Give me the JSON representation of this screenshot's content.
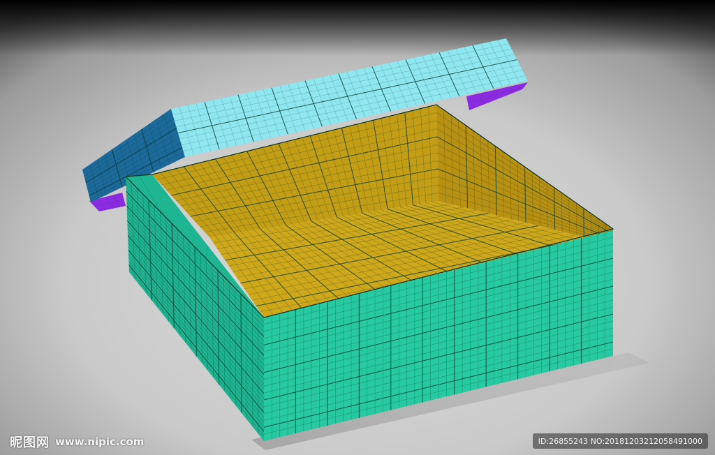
{
  "image": {
    "subject": "3D wireframe open box with hinged lid",
    "colors": {
      "floor_light": "#d7d7d7",
      "floor_dark": "#000000",
      "box_front": "#26c9a0",
      "box_left": "#1fb592",
      "box_interior": "#c39d15",
      "lid_top": "#8fe6ef",
      "lid_side": "#1c6a9c",
      "lid_underside": "#8a2be2",
      "grid_line": "#0b3b2c"
    }
  },
  "watermark": {
    "logo_text": "昵图网",
    "site_url": "www.nipic.com",
    "id_text": "ID:26855243 NO:20181203212058491000"
  }
}
